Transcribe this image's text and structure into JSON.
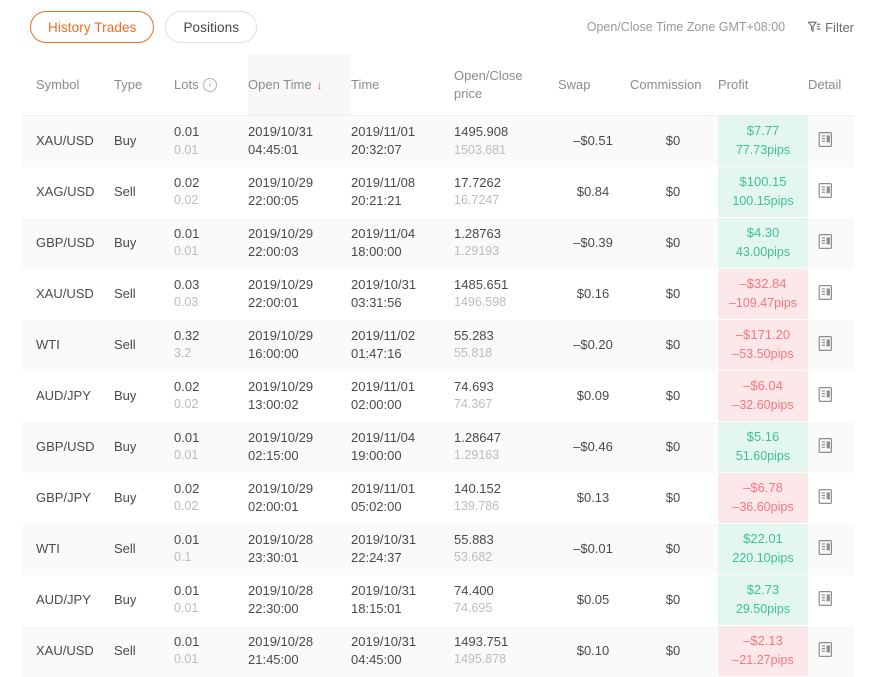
{
  "tabs": [
    {
      "label": "History Trades",
      "active": true
    },
    {
      "label": "Positions",
      "active": false
    }
  ],
  "header": {
    "timezone_note": "Open/Close Time Zone GMT+08:00",
    "filter_label": "Filter"
  },
  "columns": {
    "symbol": "Symbol",
    "type": "Type",
    "lots": "Lots",
    "open_time": "Open Time",
    "time": "Time",
    "open_close_price": "Open/Close price",
    "swap": "Swap",
    "commission": "Commission",
    "profit": "Profit",
    "detail": "Detail"
  },
  "sort": {
    "column": "Open Time",
    "direction": "desc",
    "arrow": "↓"
  },
  "colors": {
    "accent": "#ef6c26",
    "profit_positive_text": "#3fbf97",
    "profit_positive_bg": "#e3f6ef",
    "profit_negative_text": "#f4767e",
    "profit_negative_bg": "#fde8e9",
    "muted_text": "#bcbcbc"
  },
  "rows": [
    {
      "symbol": "XAU/USD",
      "type": "Buy",
      "lots": "0.01",
      "lots_sub": "0.01",
      "open_date": "2019/10/31",
      "open_clock": "04:45:01",
      "close_date": "2019/11/01",
      "close_clock": "20:32:07",
      "open_price": "1495.908",
      "close_price": "1503.681",
      "swap": "–$0.51",
      "commission": "$0",
      "profit": "$7.77",
      "pips": "77.73pips",
      "profit_sign": "pos"
    },
    {
      "symbol": "XAG/USD",
      "type": "Sell",
      "lots": "0.02",
      "lots_sub": "0.02",
      "open_date": "2019/10/29",
      "open_clock": "22:00:05",
      "close_date": "2019/11/08",
      "close_clock": "20:21:21",
      "open_price": "17.7262",
      "close_price": "16.7247",
      "swap": "$0.84",
      "commission": "$0",
      "profit": "$100.15",
      "pips": "100.15pips",
      "profit_sign": "pos"
    },
    {
      "symbol": "GBP/USD",
      "type": "Buy",
      "lots": "0.01",
      "lots_sub": "0.01",
      "open_date": "2019/10/29",
      "open_clock": "22:00:03",
      "close_date": "2019/11/04",
      "close_clock": "18:00:00",
      "open_price": "1.28763",
      "close_price": "1.29193",
      "swap": "–$0.39",
      "commission": "$0",
      "profit": "$4.30",
      "pips": "43.00pips",
      "profit_sign": "pos"
    },
    {
      "symbol": "XAU/USD",
      "type": "Sell",
      "lots": "0.03",
      "lots_sub": "0.03",
      "open_date": "2019/10/29",
      "open_clock": "22:00:01",
      "close_date": "2019/10/31",
      "close_clock": "03:31:56",
      "open_price": "1485.651",
      "close_price": "1496.598",
      "swap": "$0.16",
      "commission": "$0",
      "profit": "–$32.84",
      "pips": "–109.47pips",
      "profit_sign": "neg"
    },
    {
      "symbol": "WTI",
      "type": "Sell",
      "lots": "0.32",
      "lots_sub": "3.2",
      "open_date": "2019/10/29",
      "open_clock": "16:00:00",
      "close_date": "2019/11/02",
      "close_clock": "01:47:16",
      "open_price": "55.283",
      "close_price": "55.818",
      "swap": "–$0.20",
      "commission": "$0",
      "profit": "–$171.20",
      "pips": "–53.50pips",
      "profit_sign": "neg"
    },
    {
      "symbol": "AUD/JPY",
      "type": "Buy",
      "lots": "0.02",
      "lots_sub": "0.02",
      "open_date": "2019/10/29",
      "open_clock": "13:00:02",
      "close_date": "2019/11/01",
      "close_clock": "02:00:00",
      "open_price": "74.693",
      "close_price": "74.367",
      "swap": "$0.09",
      "commission": "$0",
      "profit": "–$6.04",
      "pips": "–32.60pips",
      "profit_sign": "neg"
    },
    {
      "symbol": "GBP/USD",
      "type": "Buy",
      "lots": "0.01",
      "lots_sub": "0.01",
      "open_date": "2019/10/29",
      "open_clock": "02:15:00",
      "close_date": "2019/11/04",
      "close_clock": "19:00:00",
      "open_price": "1.28647",
      "close_price": "1.29163",
      "swap": "–$0.46",
      "commission": "$0",
      "profit": "$5.16",
      "pips": "51.60pips",
      "profit_sign": "pos"
    },
    {
      "symbol": "GBP/JPY",
      "type": "Buy",
      "lots": "0.02",
      "lots_sub": "0.02",
      "open_date": "2019/10/29",
      "open_clock": "02:00:01",
      "close_date": "2019/11/01",
      "close_clock": "05:02:00",
      "open_price": "140.152",
      "close_price": "139.786",
      "swap": "$0.13",
      "commission": "$0",
      "profit": "–$6.78",
      "pips": "–36.60pips",
      "profit_sign": "neg"
    },
    {
      "symbol": "WTI",
      "type": "Sell",
      "lots": "0.01",
      "lots_sub": "0.1",
      "open_date": "2019/10/28",
      "open_clock": "23:30:01",
      "close_date": "2019/10/31",
      "close_clock": "22:24:37",
      "open_price": "55.883",
      "close_price": "53.682",
      "swap": "–$0.01",
      "commission": "$0",
      "profit": "$22.01",
      "pips": "220.10pips",
      "profit_sign": "pos"
    },
    {
      "symbol": "AUD/JPY",
      "type": "Buy",
      "lots": "0.01",
      "lots_sub": "0.01",
      "open_date": "2019/10/28",
      "open_clock": "22:30:00",
      "close_date": "2019/10/31",
      "close_clock": "18:15:01",
      "open_price": "74.400",
      "close_price": "74.695",
      "swap": "$0.05",
      "commission": "$0",
      "profit": "$2.73",
      "pips": "29.50pips",
      "profit_sign": "pos"
    },
    {
      "symbol": "XAU/USD",
      "type": "Sell",
      "lots": "0.01",
      "lots_sub": "0.01",
      "open_date": "2019/10/28",
      "open_clock": "21:45:00",
      "close_date": "2019/10/31",
      "close_clock": "04:45:00",
      "open_price": "1493.751",
      "close_price": "1495.878",
      "swap": "$0.10",
      "commission": "$0",
      "profit": "–$2.13",
      "pips": "–21.27pips",
      "profit_sign": "neg"
    }
  ]
}
